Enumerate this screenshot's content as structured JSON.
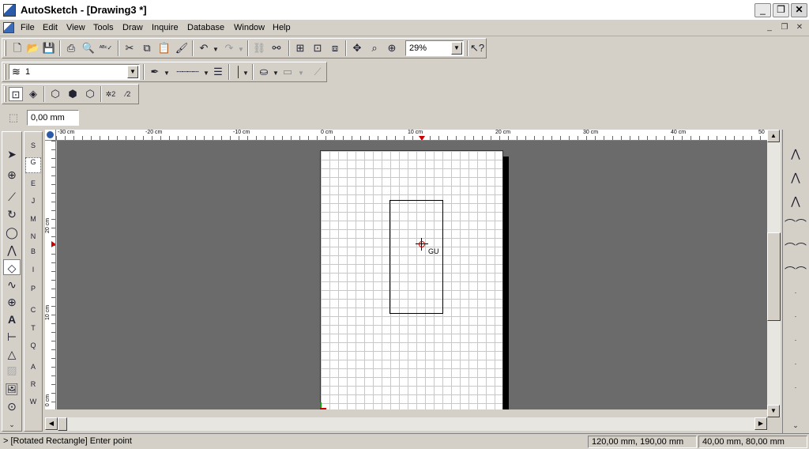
{
  "window": {
    "title": "AutoSketch - [Drawing3 *]",
    "controls": [
      "_",
      "❐",
      "✕"
    ]
  },
  "menubar": {
    "items": [
      "File",
      "Edit",
      "View",
      "Tools",
      "Draw",
      "Inquire",
      "Database",
      "Window",
      "Help"
    ],
    "mdi_controls": [
      "_",
      "❐",
      "✕"
    ]
  },
  "toolbar_standard": {
    "icons": [
      "new-icon",
      "open-icon",
      "save-icon",
      "print-icon",
      "print-preview-icon",
      "spell-check-icon",
      "cut-icon",
      "copy-icon",
      "paste-icon",
      "format-painter-icon",
      "undo-icon",
      "redo-icon",
      "link-icon",
      "unlink-icon",
      "grid-icon",
      "snap-grid-icon",
      "layers-3d-icon",
      "zoom-pan-icon",
      "zoom-window-icon",
      "zoom-in-icon",
      "help-pointer-icon"
    ],
    "zoom_value": "29%"
  },
  "toolbar_properties": {
    "layer_value": "1"
  },
  "toolbar_dimension": {
    "value": "0,00 mm"
  },
  "rulers": {
    "horizontal": [
      "-30 cm",
      "-20 cm",
      "-10 cm",
      "0 cm",
      "10 cm",
      "20 cm",
      "30 cm",
      "40 cm",
      "50"
    ],
    "vertical": [
      "20 cm",
      "10 cm",
      "0 cm"
    ]
  },
  "left_tools": {
    "main": [
      "select-arrow-icon",
      "zoom-icon",
      "line-icon",
      "arc-icon",
      "circle-icon",
      "polyline-icon",
      "rectangle-icon",
      "curve-icon",
      "point-icon",
      "text-icon",
      "dimension-icon",
      "triangle-icon",
      "hatch-icon",
      "image-icon",
      "symbol-icon"
    ],
    "snap": [
      "S",
      "G",
      "E",
      "J",
      "M",
      "N",
      "B",
      "I",
      "P",
      "C",
      "T",
      "Q",
      "A",
      "R",
      "W"
    ]
  },
  "canvas": {
    "cursor_label": "GU"
  },
  "status": {
    "message": "> [Rotated Rectangle] Enter point",
    "coord1": "120,00 mm, 190,00 mm",
    "coord2": "40,00 mm, 80,00 mm"
  }
}
